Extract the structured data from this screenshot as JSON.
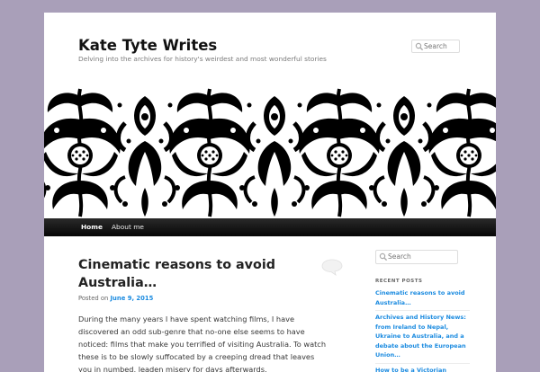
{
  "site": {
    "title": "Kate Tyte Writes",
    "description": "Delving into the archives for history's weirdest and most wonderful stories"
  },
  "header_search": {
    "placeholder": "Search"
  },
  "nav": {
    "items": [
      {
        "label": "Home"
      },
      {
        "label": "About me"
      }
    ]
  },
  "post": {
    "title": "Cinematic reasons to avoid Australia…",
    "posted_on_label": "Posted on",
    "date": "June 9, 2015",
    "excerpt": "During the many years I have spent watching films, I have discovered an odd sub-genre that no-one else seems to have noticed: films that make you terrified of visiting Australia. To watch these is to be slowly suffocated by a creeping dread that leaves you in numbed, leaden misery for days afterwards."
  },
  "sidebar": {
    "search_placeholder": "Search",
    "recent_heading": "RECENT POSTS",
    "recent_posts": [
      {
        "title": "Cinematic reasons to avoid Australia…"
      },
      {
        "title": "Archives and History News: from Ireland to Nepal, Ukraine to Australia, and a debate about the European Union…"
      },
      {
        "title": "How to be a Victorian"
      }
    ]
  },
  "colors": {
    "background": "#a99fb9",
    "link": "#1b8be0",
    "nav_bar": "#111111"
  },
  "icons": {
    "search": "search-icon",
    "comment": "comment-bubble-icon"
  }
}
